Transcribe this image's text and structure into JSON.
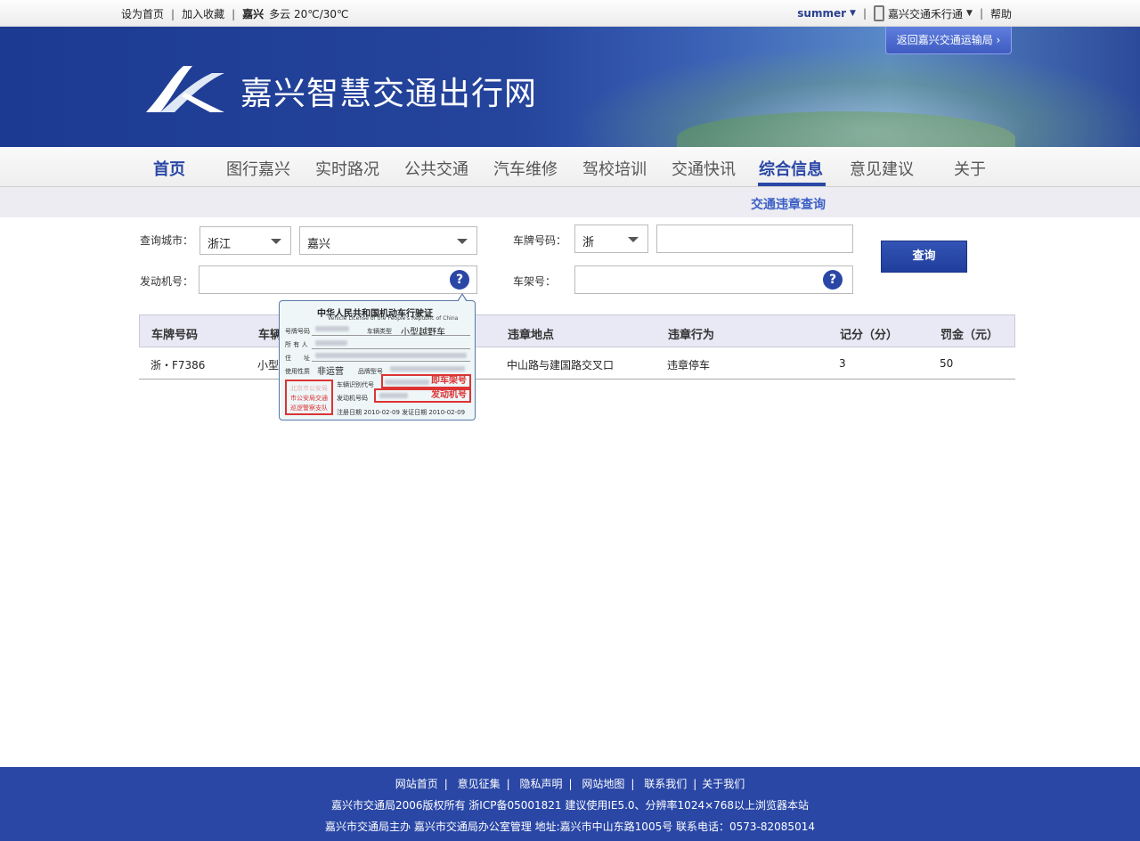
{
  "topbar": {
    "set_home": "设为首页",
    "add_favorite": "加入收藏",
    "city": "嘉兴",
    "weather": "多云 20℃/30℃",
    "user": "summer",
    "app": "嘉兴交通禾行通",
    "help": "帮助"
  },
  "banner": {
    "title": "嘉兴智慧交通出行网",
    "return_button": "返回嘉兴交通运输局 ›"
  },
  "nav": {
    "items": [
      "首页",
      "图行嘉兴",
      "实时路况",
      "公共交通",
      "汽车维修",
      "驾校培训",
      "交通快讯",
      "综合信息",
      "意见建议",
      "关于"
    ],
    "active": "综合信息",
    "sub_item": "交通违章查询"
  },
  "form": {
    "city_label": "查询城市：",
    "province_value": "浙江",
    "city_value": "嘉兴",
    "plate_label": "车牌号码：",
    "plate_prefix": "浙",
    "plate_value": "",
    "engine_label": "发动机号：",
    "engine_value": "",
    "frame_label": "车架号：",
    "frame_value": "",
    "help_icon": "?",
    "query_button": "查询"
  },
  "table": {
    "headers": [
      "车牌号码",
      "车辆",
      "违章地点",
      "违章行为",
      "记分（分）",
      "罚金（元）"
    ],
    "rows": [
      {
        "plate": "浙・F7386",
        "type": "小型",
        "location": "中山路与建国路交叉口",
        "action": "违章停车",
        "points": "3",
        "fine": "50"
      }
    ]
  },
  "tooltip": {
    "title": "中华人民共和国机动车行驶证",
    "subtitle": "Vehicle License of the People's Republic of China",
    "plate_no_label": "号牌号码",
    "vehicle_type_label": "车辆类型",
    "vehicle_type_value": "小型越野车",
    "owner_label": "所 有 人",
    "address_label": "住　　址",
    "usage_label": "使用性质",
    "usage_value": "非运营",
    "brand_label": "品牌型号",
    "vin_label": "车辆识别代号",
    "vin_marker": "即车架号",
    "engine_label": "发动机号码",
    "engine_marker": "发动机号",
    "stamp_line1": "北京市公安局",
    "stamp_line2": "市公安局交通",
    "stamp_line3": "巡逻警察支队",
    "register_date": "注册日期 2010-02-09  发证日期 2010-02-09"
  },
  "footer": {
    "links": [
      "网站首页",
      "意见征集",
      "隐私声明",
      "网站地图",
      "联系我们",
      "关于我们"
    ],
    "line2": "嘉兴市交通局2006版权所有  浙ICP备05001821  建议使用IE5.0、分辨率1024×768以上浏览器本站",
    "line3": "嘉兴市交通局主办  嘉兴市交通局办公室管理   地址:嘉兴市中山东路1005号  联系电话：0573-82085014"
  }
}
